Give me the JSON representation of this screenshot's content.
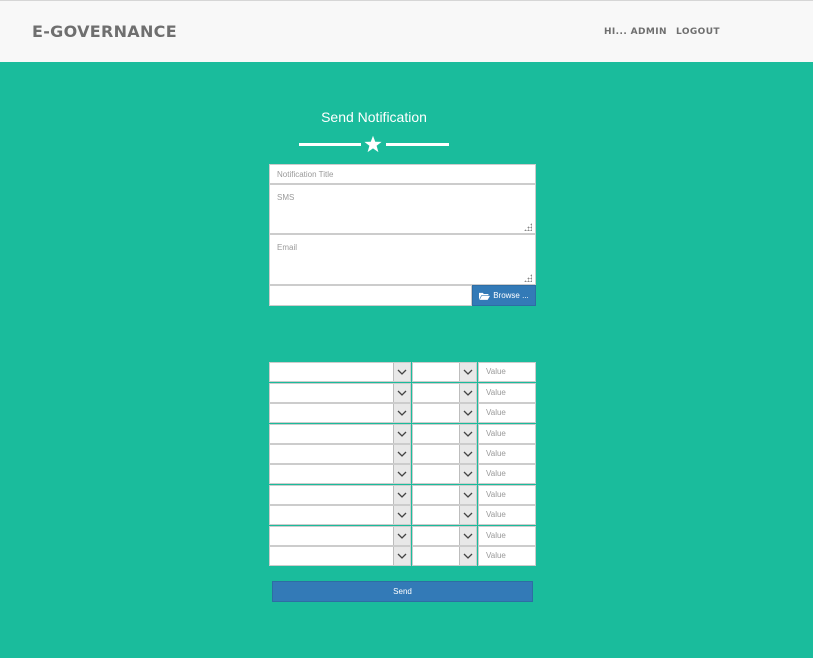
{
  "navbar": {
    "brand": "E-GOVERNANCE",
    "greeting": "HI... ADMIN",
    "logout": "LOGOUT"
  },
  "form": {
    "title": "Send Notification",
    "notification_title_placeholder": "Notification Title",
    "sms_placeholder": "SMS",
    "email_placeholder": "Email",
    "file_value": "",
    "browse_label": "Browse ...",
    "send_label": "Send"
  },
  "filters": {
    "rows": [
      {
        "field": "",
        "operator": "",
        "value_placeholder": "Value"
      },
      {
        "field": "",
        "operator": "",
        "value_placeholder": "Value"
      },
      {
        "field": "",
        "operator": "",
        "value_placeholder": "Value"
      },
      {
        "field": "",
        "operator": "",
        "value_placeholder": "Value"
      },
      {
        "field": "",
        "operator": "",
        "value_placeholder": "Value"
      },
      {
        "field": "",
        "operator": "",
        "value_placeholder": "Value"
      },
      {
        "field": "",
        "operator": "",
        "value_placeholder": "Value"
      },
      {
        "field": "",
        "operator": "",
        "value_placeholder": "Value"
      },
      {
        "field": "",
        "operator": "",
        "value_placeholder": "Value"
      },
      {
        "field": "",
        "operator": "",
        "value_placeholder": "Value"
      }
    ]
  },
  "colors": {
    "background": "#1abc9c",
    "navbar": "#f8f8f8",
    "primary_button": "#337ab7"
  },
  "icons": {
    "divider": "star-icon",
    "browse": "folder-open-icon",
    "dropdown": "chevron-down-icon"
  }
}
